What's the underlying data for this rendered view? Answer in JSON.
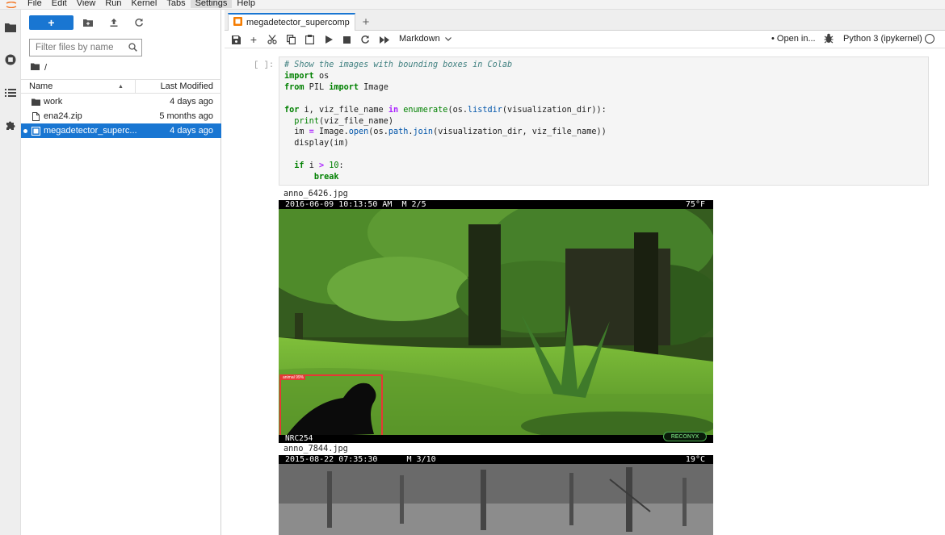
{
  "menubar": {
    "items": [
      "File",
      "Edit",
      "View",
      "Run",
      "Kernel",
      "Tabs",
      "Settings",
      "Help"
    ],
    "active": "Settings"
  },
  "filebrowser": {
    "new_label": "+",
    "filter_placeholder": "Filter files by name",
    "breadcrumb": "/",
    "columns": {
      "name": "Name",
      "modified": "Last Modified"
    },
    "files": [
      {
        "name": "work",
        "type": "folder",
        "modified": "4 days ago"
      },
      {
        "name": "ena24.zip",
        "type": "file",
        "modified": "5 months ago"
      },
      {
        "name": "megadetector_superc...",
        "type": "notebook",
        "modified": "4 days ago",
        "selected": true
      }
    ]
  },
  "tabs": {
    "notebook_tab": "megadetector_supercompu",
    "add_label": "+"
  },
  "toolbar": {
    "cell_type": "Markdown",
    "open_in": "Open in...",
    "kernel": "Python 3 (ipykernel)"
  },
  "cell": {
    "prompt": "[ ]:"
  },
  "outputs": {
    "image1_name": "anno_6426.jpg",
    "image1_stamp": "2016-06-09 10:13:50 AM  M 2/5",
    "image1_stamp_right": "75°F",
    "image1_bottom": "NRC254",
    "image1_logo": "RECONYX",
    "image1_bbox_label": "animal 99%",
    "image2_name": "anno_7844.jpg",
    "image2_stamp": "2015-08-22 07:35:30      M 3/10",
    "image2_stamp_right": "19°C"
  },
  "colors": {
    "accent": "#1976d2",
    "bbox": "#e53935"
  }
}
